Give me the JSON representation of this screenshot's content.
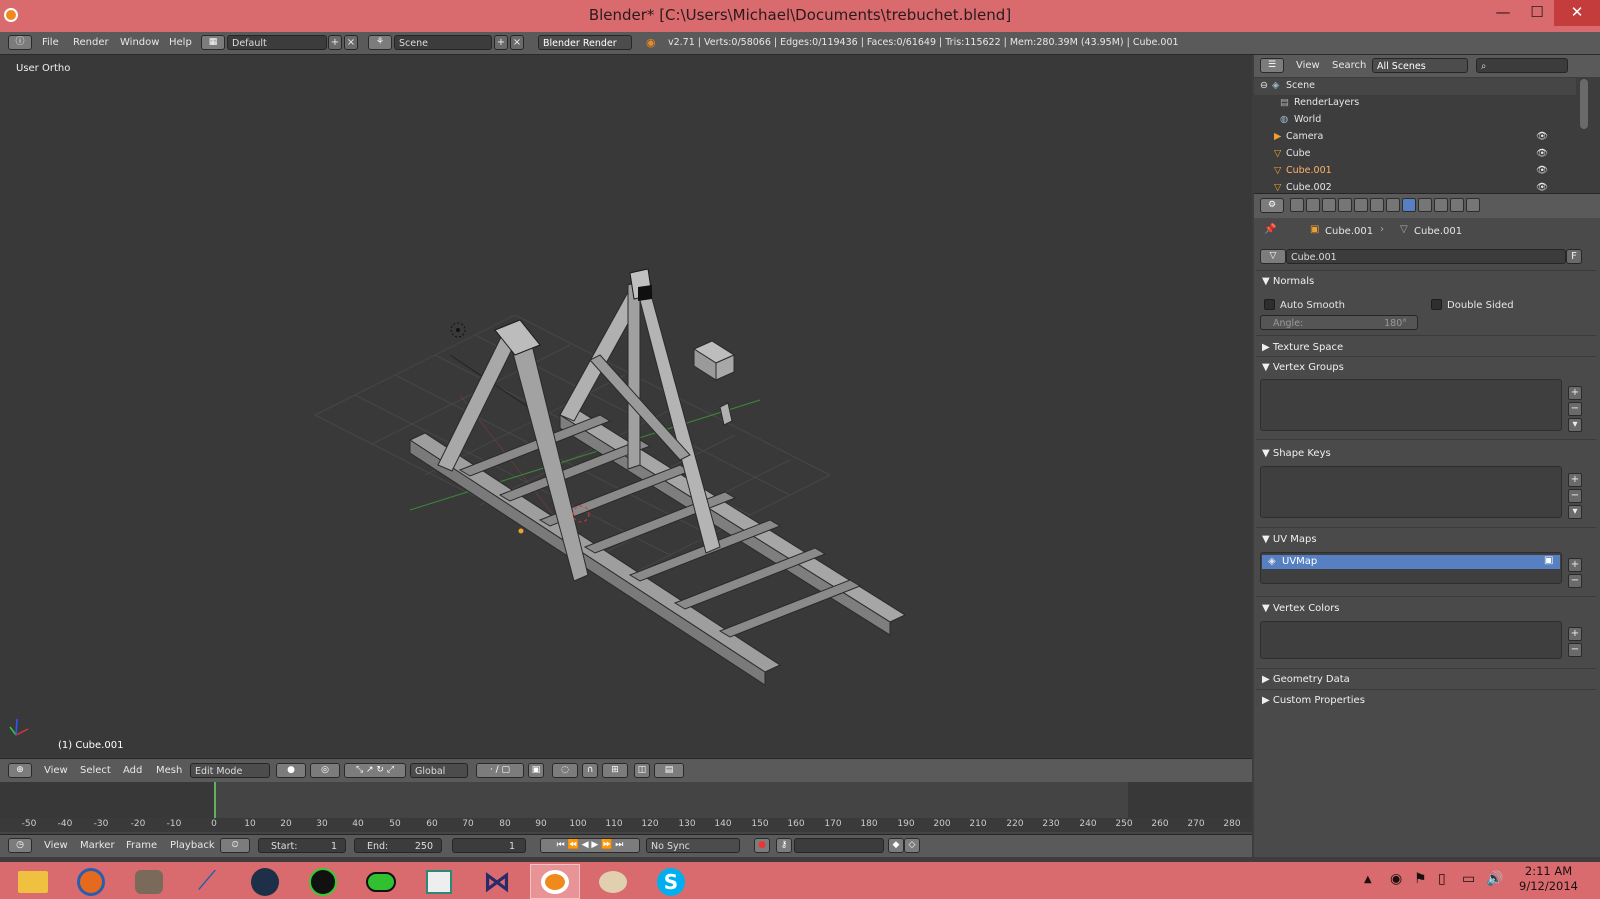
{
  "window": {
    "title": "Blender* [C:\\Users\\Michael\\Documents\\trebuchet.blend]",
    "min_label": "—",
    "max_label": "☐",
    "close_label": "✕"
  },
  "info_header": {
    "menus": [
      "File",
      "Render",
      "Window",
      "Help"
    ],
    "layout_value": "Default",
    "scene_value": "Scene",
    "engine_value": "Blender Render",
    "stats": "v2.71 | Verts:0/58066 | Edges:0/119436 | Faces:0/61649 | Tris:115622 | Mem:280.39M (43.95M) | Cube.001"
  },
  "viewport": {
    "label": "User Ortho",
    "selected_object": "(1) Cube.001"
  },
  "view3d_header": {
    "menus": [
      "View",
      "Select",
      "Add",
      "Mesh"
    ],
    "mode_value": "Edit Mode",
    "orientation_value": "Global"
  },
  "timeline": {
    "ticks": [
      "-50",
      "-40",
      "-30",
      "-20",
      "-10",
      "0",
      "10",
      "20",
      "30",
      "40",
      "50",
      "60",
      "70",
      "80",
      "90",
      "100",
      "110",
      "120",
      "130",
      "140",
      "150",
      "160",
      "170",
      "180",
      "190",
      "200",
      "210",
      "220",
      "230",
      "240",
      "250",
      "260",
      "270",
      "280"
    ],
    "menus": [
      "View",
      "Marker",
      "Frame",
      "Playback"
    ],
    "start_label": "Start:",
    "start_value": "1",
    "end_label": "End:",
    "end_value": "250",
    "current_frame": "1",
    "sync_value": "No Sync"
  },
  "outliner": {
    "menus": [
      "View",
      "Search"
    ],
    "filter_value": "All Scenes",
    "rows": [
      {
        "label": "Scene"
      },
      {
        "label": "RenderLayers"
      },
      {
        "label": "World"
      },
      {
        "label": "Camera"
      },
      {
        "label": "Cube"
      },
      {
        "label": "Cube.001"
      },
      {
        "label": "Cube.002"
      }
    ]
  },
  "properties": {
    "breadcrumb_object": "Cube.001",
    "breadcrumb_mesh": "Cube.001",
    "mesh_name": "Cube.001",
    "fake_user": "F",
    "normals": {
      "title": "Normals",
      "auto_smooth": "Auto Smooth",
      "double_sided": "Double Sided",
      "angle_label": "Angle:",
      "angle_value": "180°"
    },
    "texture_space": "Texture Space",
    "vertex_groups": "Vertex Groups",
    "shape_keys": "Shape Keys",
    "uv_maps": {
      "title": "UV Maps",
      "item": "UVMap"
    },
    "vertex_colors": "Vertex Colors",
    "geometry_data": "Geometry Data",
    "custom_properties": "Custom Properties"
  },
  "taskbar": {
    "time": "2:11 AM",
    "date": "9/12/2014"
  },
  "colors": {
    "title_bar": "#d96b6f",
    "selected_highlight": "#5680c2",
    "selected_text": "#ffb36b"
  }
}
